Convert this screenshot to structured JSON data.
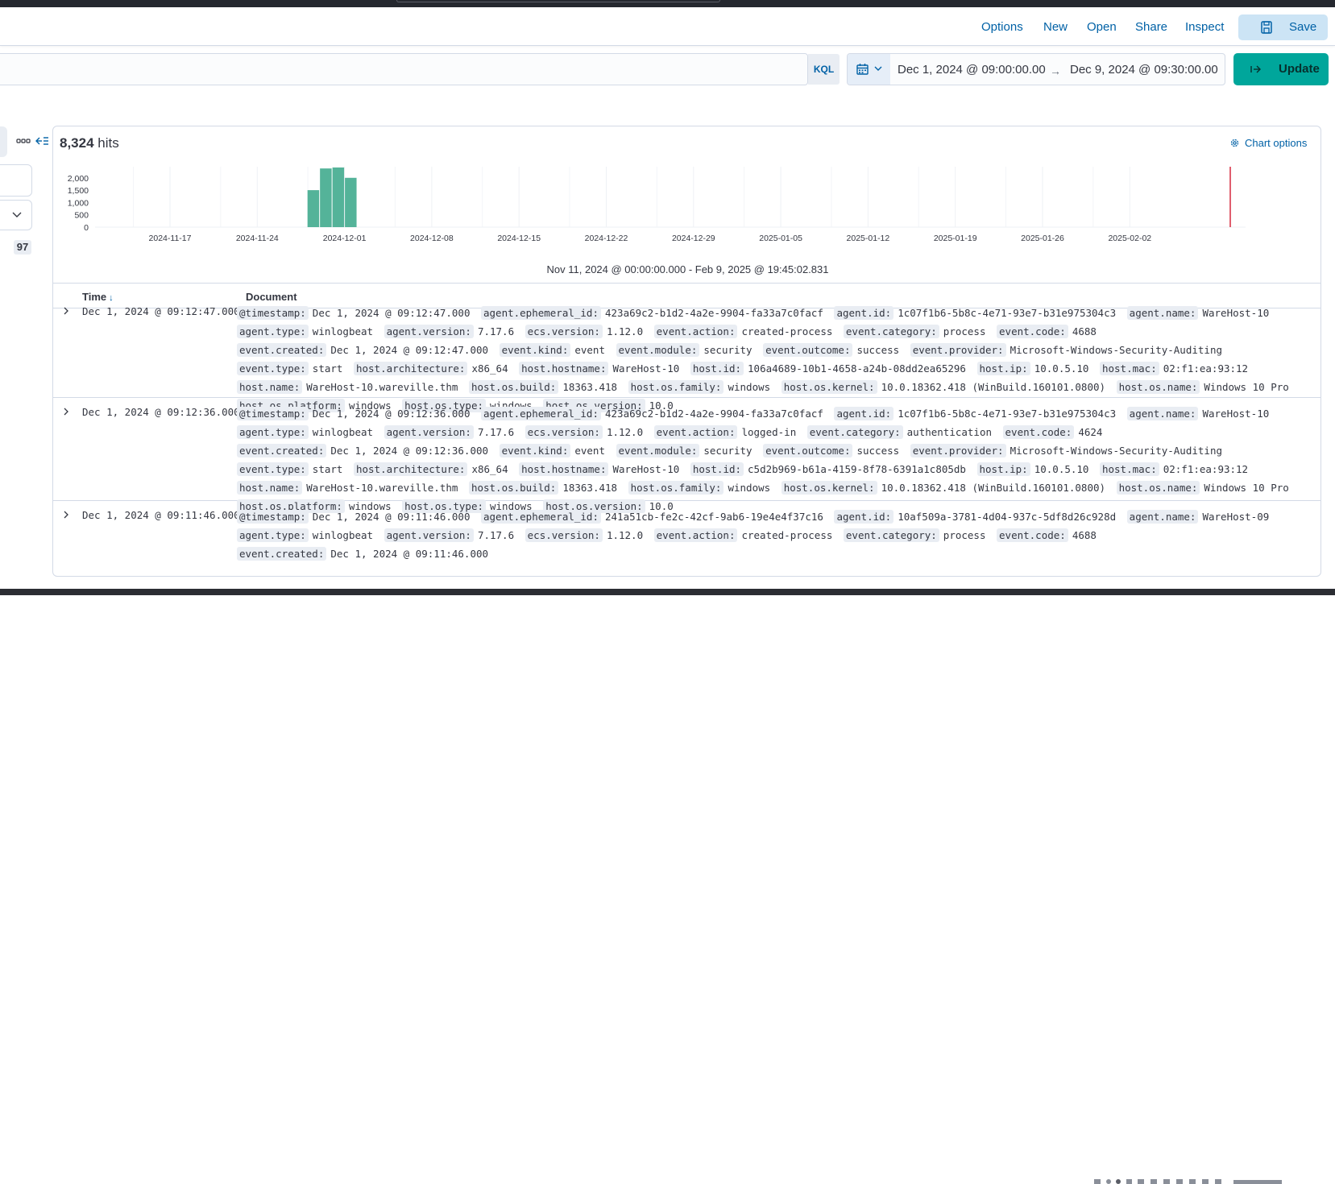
{
  "header": {
    "menu": [
      "Options",
      "New",
      "Open",
      "Share",
      "Inspect"
    ],
    "save_label": "Save"
  },
  "query": {
    "language": "KQL",
    "date_start": "Dec 1, 2024 @ 09:00:00.00",
    "date_arrow": "→",
    "date_end": "Dec 9, 2024 @ 09:30:00.00",
    "update_label": "Update"
  },
  "sidebar": {
    "count": "97"
  },
  "results": {
    "hits_count": "8,324",
    "hits_label": "hits",
    "chart_options_label": "Chart options",
    "time_range": "Nov 11, 2024 @ 00:00:00.000 - Feb 9, 2025 @ 19:45:02.831",
    "col_time": "Time",
    "col_document": "Document"
  },
  "chart_data": {
    "type": "bar",
    "yticks": [
      "2,000",
      "1,500",
      "1,000",
      "500",
      "0"
    ],
    "ylim": [
      0,
      2450
    ],
    "xticks": [
      "2024-11-17",
      "2024-11-24",
      "2024-12-01",
      "2024-12-08",
      "2024-12-15",
      "2024-12-22",
      "2024-12-29",
      "2025-01-05",
      "2025-01-12",
      "2025-01-19",
      "2025-01-26",
      "2025-02-02"
    ],
    "bars": [
      {
        "x": "2024-11-28",
        "value": 1500
      },
      {
        "x": "2024-11-29",
        "value": 2380
      },
      {
        "x": "2024-11-30",
        "value": 2420
      },
      {
        "x": "2024-12-01",
        "value": 2000
      }
    ],
    "color": "#54b399",
    "now_marker_color": "#d6293e"
  },
  "rows": [
    {
      "time": "Dec 1, 2024 @ 09:12:47.000",
      "fields": [
        [
          "@timestamp:",
          "Dec 1, 2024 @ 09:12:47.000"
        ],
        [
          "agent.ephemeral_id:",
          "423a69c2-b1d2-4a2e-9904-fa33a7c0facf"
        ],
        [
          "agent.id:",
          "1c07f1b6-5b8c-4e71-93e7-b31e975304c3"
        ],
        [
          "agent.name:",
          "WareHost-10"
        ],
        [
          "agent.type:",
          "winlogbeat"
        ],
        [
          "agent.version:",
          "7.17.6"
        ],
        [
          "ecs.version:",
          "1.12.0"
        ],
        [
          "event.action:",
          "created-process"
        ],
        [
          "event.category:",
          "process"
        ],
        [
          "event.code:",
          "4688"
        ],
        [
          "event.created:",
          "Dec 1, 2024 @ 09:12:47.000"
        ],
        [
          "event.kind:",
          "event"
        ],
        [
          "event.module:",
          "security"
        ],
        [
          "event.outcome:",
          "success"
        ],
        [
          "event.provider:",
          "Microsoft-Windows-Security-Auditing"
        ],
        [
          "event.type:",
          "start"
        ],
        [
          "host.architecture:",
          "x86_64"
        ],
        [
          "host.hostname:",
          "WareHost-10"
        ],
        [
          "host.id:",
          "106a4689-10b1-4658-a24b-08dd2ea65296"
        ],
        [
          "host.ip:",
          "10.0.5.10"
        ],
        [
          "host.mac:",
          "02:f1:ea:93:12"
        ],
        [
          "host.name:",
          "WareHost-10.wareville.thm"
        ],
        [
          "host.os.build:",
          "18363.418"
        ],
        [
          "host.os.family:",
          "windows"
        ],
        [
          "host.os.kernel:",
          "10.0.18362.418 (WinBuild.160101.0800)"
        ],
        [
          "host.os.name:",
          "Windows 10 Pro"
        ],
        [
          "host.os.platform:",
          "windows"
        ],
        [
          "host.os.type:",
          "windows"
        ],
        [
          "host.os.version:",
          "10.0"
        ]
      ]
    },
    {
      "time": "Dec 1, 2024 @ 09:12:36.000",
      "fields": [
        [
          "@timestamp:",
          "Dec 1, 2024 @ 09:12:36.000"
        ],
        [
          "agent.ephemeral_id:",
          "423a69c2-b1d2-4a2e-9904-fa33a7c0facf"
        ],
        [
          "agent.id:",
          "1c07f1b6-5b8c-4e71-93e7-b31e975304c3"
        ],
        [
          "agent.name:",
          "WareHost-10"
        ],
        [
          "agent.type:",
          "winlogbeat"
        ],
        [
          "agent.version:",
          "7.17.6"
        ],
        [
          "ecs.version:",
          "1.12.0"
        ],
        [
          "event.action:",
          "logged-in"
        ],
        [
          "event.category:",
          "authentication"
        ],
        [
          "event.code:",
          "4624"
        ],
        [
          "event.created:",
          "Dec 1, 2024 @ 09:12:36.000"
        ],
        [
          "event.kind:",
          "event"
        ],
        [
          "event.module:",
          "security"
        ],
        [
          "event.outcome:",
          "success"
        ],
        [
          "event.provider:",
          "Microsoft-Windows-Security-Auditing"
        ],
        [
          "event.type:",
          "start"
        ],
        [
          "host.architecture:",
          "x86_64"
        ],
        [
          "host.hostname:",
          "WareHost-10"
        ],
        [
          "host.id:",
          "c5d2b969-b61a-4159-8f78-6391a1c805db"
        ],
        [
          "host.ip:",
          "10.0.5.10"
        ],
        [
          "host.mac:",
          "02:f1:ea:93:12"
        ],
        [
          "host.name:",
          "WareHost-10.wareville.thm"
        ],
        [
          "host.os.build:",
          "18363.418"
        ],
        [
          "host.os.family:",
          "windows"
        ],
        [
          "host.os.kernel:",
          "10.0.18362.418 (WinBuild.160101.0800)"
        ],
        [
          "host.os.name:",
          "Windows 10 Pro"
        ],
        [
          "host.os.platform:",
          "windows"
        ],
        [
          "host.os.type:",
          "windows"
        ],
        [
          "host.os.version:",
          "10.0"
        ]
      ]
    },
    {
      "time": "Dec 1, 2024 @ 09:11:46.000",
      "fields": [
        [
          "@timestamp:",
          "Dec 1, 2024 @ 09:11:46.000"
        ],
        [
          "agent.ephemeral_id:",
          "241a51cb-fe2c-42cf-9ab6-19e4e4f37c16"
        ],
        [
          "agent.id:",
          "10af509a-3781-4d04-937c-5df8d26c928d"
        ],
        [
          "agent.name:",
          "WareHost-09"
        ],
        [
          "agent.type:",
          "winlogbeat"
        ],
        [
          "agent.version:",
          "7.17.6"
        ],
        [
          "ecs.version:",
          "1.12.0"
        ],
        [
          "event.action:",
          "created-process"
        ],
        [
          "event.category:",
          "process"
        ],
        [
          "event.code:",
          "4688"
        ],
        [
          "event.created:",
          "Dec 1, 2024 @ 09:11:46.000"
        ]
      ]
    }
  ]
}
